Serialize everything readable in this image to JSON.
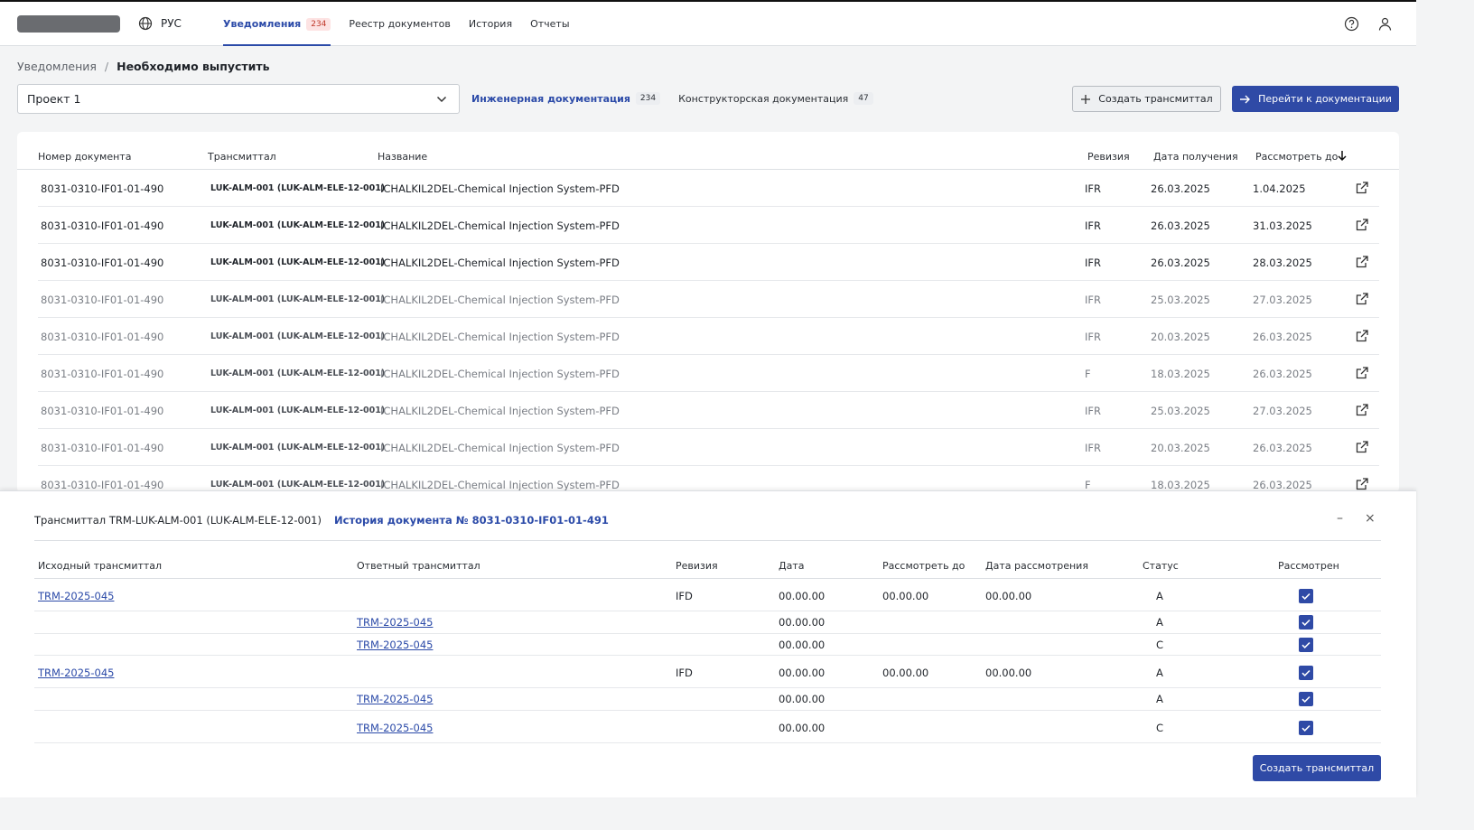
{
  "header": {
    "lang": "РУС",
    "nav": [
      {
        "label": "Уведомления",
        "badge": "234"
      },
      {
        "label": "Реестр документов"
      },
      {
        "label": "История"
      },
      {
        "label": "Отчеты"
      }
    ]
  },
  "breadcrumb": {
    "parent": "Уведомления",
    "separator": "/",
    "current": "Необходимо выпустить"
  },
  "project_select": {
    "value": "Проект 1"
  },
  "doc_tabs": [
    {
      "label": "Инженерная документация",
      "count": "234"
    },
    {
      "label": "Конструкторская документация",
      "count": "47"
    }
  ],
  "buttons": {
    "create_transmittal": "Создать трансмиттал",
    "go_to_docs": "Перейти к документации"
  },
  "main_table": {
    "columns": [
      "Номер документа",
      "Трансмиттал",
      "Название",
      "Ревизия",
      "Дата получения",
      "Рассмотреть до"
    ],
    "rows": [
      {
        "num": "8031-0310-IF01-01-490",
        "tr": "LUK-ALM-001 (LUK-ALM-ELE-12-001)",
        "name": "ICHALKIL2DEL-Chemical Injection System-PFD",
        "rev": "IFR",
        "recv": "26.03.2025",
        "due": "1.04.2025"
      },
      {
        "num": "8031-0310-IF01-01-490",
        "tr": "LUK-ALM-001 (LUK-ALM-ELE-12-001)",
        "name": "ICHALKIL2DEL-Chemical Injection System-PFD",
        "rev": "IFR",
        "recv": "26.03.2025",
        "due": "31.03.2025"
      },
      {
        "num": "8031-0310-IF01-01-490",
        "tr": "LUK-ALM-001 (LUK-ALM-ELE-12-001)",
        "name": "ICHALKIL2DEL-Chemical Injection System-PFD",
        "rev": "IFR",
        "recv": "26.03.2025",
        "due": "28.03.2025"
      },
      {
        "num": "8031-0310-IF01-01-490",
        "tr": "LUK-ALM-001 (LUK-ALM-ELE-12-001)",
        "name": "ICHALKIL2DEL-Chemical Injection System-PFD",
        "rev": "IFR",
        "recv": "25.03.2025",
        "due": "27.03.2025"
      },
      {
        "num": "8031-0310-IF01-01-490",
        "tr": "LUK-ALM-001 (LUK-ALM-ELE-12-001)",
        "name": "ICHALKIL2DEL-Chemical Injection System-PFD",
        "rev": "IFR",
        "recv": "20.03.2025",
        "due": "26.03.2025"
      },
      {
        "num": "8031-0310-IF01-01-490",
        "tr": "LUK-ALM-001 (LUK-ALM-ELE-12-001)",
        "name": "ICHALKIL2DEL-Chemical Injection System-PFD",
        "rev": "F",
        "recv": "18.03.2025",
        "due": "26.03.2025"
      },
      {
        "num": "8031-0310-IF01-01-490",
        "tr": "LUK-ALM-001 (LUK-ALM-ELE-12-001)",
        "name": "ICHALKIL2DEL-Chemical Injection System-PFD",
        "rev": "IFR",
        "recv": "25.03.2025",
        "due": "27.03.2025"
      },
      {
        "num": "8031-0310-IF01-01-490",
        "tr": "LUK-ALM-001 (LUK-ALM-ELE-12-001)",
        "name": "ICHALKIL2DEL-Chemical Injection System-PFD",
        "rev": "IFR",
        "recv": "20.03.2025",
        "due": "26.03.2025"
      },
      {
        "num": "8031-0310-IF01-01-490",
        "tr": "LUK-ALM-001 (LUK-ALM-ELE-12-001)",
        "name": "ICHALKIL2DEL-Chemical Injection System-PFD",
        "rev": "F",
        "recv": "18.03.2025",
        "due": "26.03.2025"
      }
    ]
  },
  "panel": {
    "title": "Трансмиттал TRM-LUK-ALM-001 (LUK-ALM-ELE-12-001)",
    "history_link": "История документа № 8031-0310-IF01-01-491",
    "minimize": "–",
    "close": "×",
    "columns": [
      "Исходный трансмиттал",
      "Ответный трансмиттал",
      "Ревизия",
      "Дата",
      "Рассмотреть до",
      "Дата рассмотрения",
      "Статус",
      "Рассмотрен"
    ],
    "rows": [
      {
        "src": "TRM-2025-045",
        "resp": "",
        "rev": "IFD",
        "date": "00.00.00",
        "due": "00.00.00",
        "reviewed_date": "00.00.00",
        "status": "A",
        "checked": true
      },
      {
        "src": "",
        "resp": "TRM-2025-045",
        "rev": "",
        "date": "00.00.00",
        "due": "",
        "reviewed_date": "",
        "status": "A",
        "checked": true
      },
      {
        "src": "",
        "resp": "TRM-2025-045",
        "rev": "",
        "date": "00.00.00",
        "due": "",
        "reviewed_date": "",
        "status": "C",
        "checked": true
      },
      {
        "src": "TRM-2025-045",
        "resp": "",
        "rev": "IFD",
        "date": "00.00.00",
        "due": "00.00.00",
        "reviewed_date": "00.00.00",
        "status": "A",
        "checked": true
      },
      {
        "src": "",
        "resp": "TRM-2025-045",
        "rev": "",
        "date": "00.00.00",
        "due": "",
        "reviewed_date": "",
        "status": "A",
        "checked": true
      },
      {
        "src": "",
        "resp": "TRM-2025-045",
        "rev": "",
        "date": "00.00.00",
        "due": "",
        "reviewed_date": "",
        "status": "C",
        "checked": true
      }
    ],
    "create_button": "Создать трансмиттал"
  },
  "colors": {
    "accent": "#2f4aa6",
    "badge_red": "#c0392b"
  }
}
